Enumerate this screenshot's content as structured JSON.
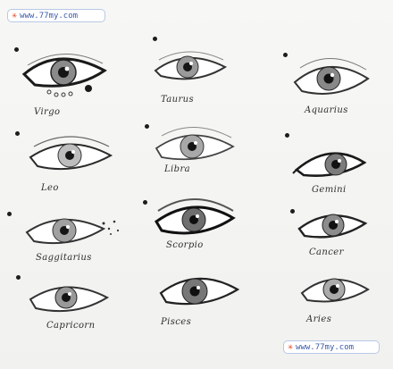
{
  "watermark": {
    "text": "www.77my.com",
    "star_icon": "asterisk-icon",
    "brand_color": "#3a5aa8",
    "star_color": "#e0451f"
  },
  "eyes": [
    {
      "label": "Virgo"
    },
    {
      "label": "Taurus"
    },
    {
      "label": "Aquarius"
    },
    {
      "label": "Leo"
    },
    {
      "label": "Libra"
    },
    {
      "label": "Gemini"
    },
    {
      "label": "Saggitarius"
    },
    {
      "label": "Scorpio"
    },
    {
      "label": "Cancer"
    },
    {
      "label": "Capricorn"
    },
    {
      "label": "Pisces"
    },
    {
      "label": "Aries"
    }
  ]
}
